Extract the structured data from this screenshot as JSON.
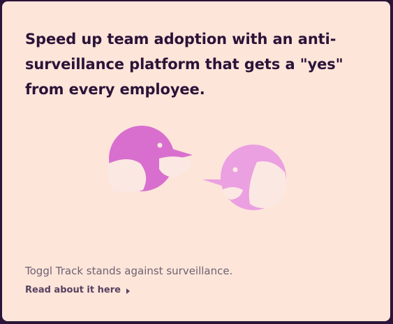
{
  "card": {
    "headline": "Speed up team adoption with an anti-surveillance platform that gets a \"yes\" from every employee.",
    "body": "Toggl Track stands against surveillance.",
    "link_label": "Read about it here",
    "link_icon": "chevron-right-icon",
    "illustration_icon": "two-birds-illustration"
  },
  "colors": {
    "page_background": "#2c1338",
    "card_background": "#fde5da",
    "text_primary": "#2c1338",
    "text_secondary": "#6e6270",
    "bird_dark": "#d86fcf",
    "bird_light": "#eba0e1"
  }
}
